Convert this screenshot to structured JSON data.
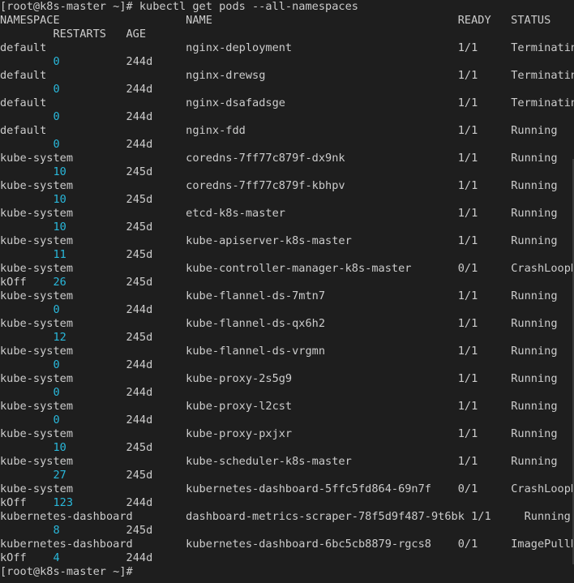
{
  "prompt_start": "[root@k8s-master ~]# kubectl get pods --all-namespaces",
  "prompt_end": "[root@k8s-master ~]#",
  "header": {
    "line1": "NAMESPACE                   NAME                                     READY   STATUS",
    "line2": "        RESTARTS   AGE"
  },
  "pods": [
    {
      "namespace": "default",
      "name": "nginx-deployment",
      "ready": "1/1",
      "status": "Terminating",
      "overflow": "",
      "restarts": "0",
      "age": "244d"
    },
    {
      "namespace": "default",
      "name": "nginx-drewsg",
      "ready": "1/1",
      "status": "Terminating",
      "overflow": "",
      "restarts": "0",
      "age": "244d"
    },
    {
      "namespace": "default",
      "name": "nginx-dsafadsge",
      "ready": "1/1",
      "status": "Terminating",
      "overflow": "",
      "restarts": "0",
      "age": "244d"
    },
    {
      "namespace": "default",
      "name": "nginx-fdd",
      "ready": "1/1",
      "status": "Running",
      "overflow": "",
      "restarts": "0",
      "age": "244d"
    },
    {
      "namespace": "kube-system",
      "name": "coredns-7ff77c879f-dx9nk",
      "ready": "1/1",
      "status": "Running",
      "overflow": "",
      "restarts": "10",
      "age": "245d"
    },
    {
      "namespace": "kube-system",
      "name": "coredns-7ff77c879f-kbhpv",
      "ready": "1/1",
      "status": "Running",
      "overflow": "",
      "restarts": "10",
      "age": "245d"
    },
    {
      "namespace": "kube-system",
      "name": "etcd-k8s-master",
      "ready": "1/1",
      "status": "Running",
      "overflow": "",
      "restarts": "10",
      "age": "245d"
    },
    {
      "namespace": "kube-system",
      "name": "kube-apiserver-k8s-master",
      "ready": "1/1",
      "status": "Running",
      "overflow": "",
      "restarts": "11",
      "age": "245d"
    },
    {
      "namespace": "kube-system",
      "name": "kube-controller-manager-k8s-master",
      "ready": "0/1",
      "status": "CrashLoopBac",
      "overflow": "kOff",
      "restarts": "26",
      "age": "245d"
    },
    {
      "namespace": "kube-system",
      "name": "kube-flannel-ds-7mtn7",
      "ready": "1/1",
      "status": "Running",
      "overflow": "",
      "restarts": "0",
      "age": "244d"
    },
    {
      "namespace": "kube-system",
      "name": "kube-flannel-ds-qx6h2",
      "ready": "1/1",
      "status": "Running",
      "overflow": "",
      "restarts": "12",
      "age": "245d"
    },
    {
      "namespace": "kube-system",
      "name": "kube-flannel-ds-vrgmn",
      "ready": "1/1",
      "status": "Running",
      "overflow": "",
      "restarts": "0",
      "age": "244d"
    },
    {
      "namespace": "kube-system",
      "name": "kube-proxy-2s5g9",
      "ready": "1/1",
      "status": "Running",
      "overflow": "",
      "restarts": "0",
      "age": "244d"
    },
    {
      "namespace": "kube-system",
      "name": "kube-proxy-l2cst",
      "ready": "1/1",
      "status": "Running",
      "overflow": "",
      "restarts": "0",
      "age": "244d"
    },
    {
      "namespace": "kube-system",
      "name": "kube-proxy-pxjxr",
      "ready": "1/1",
      "status": "Running",
      "overflow": "",
      "restarts": "10",
      "age": "245d"
    },
    {
      "namespace": "kube-system",
      "name": "kube-scheduler-k8s-master",
      "ready": "1/1",
      "status": "Running",
      "overflow": "",
      "restarts": "27",
      "age": "245d"
    },
    {
      "namespace": "kube-system",
      "name": "kubernetes-dashboard-5ffc5fd864-69n7f",
      "ready": "0/1",
      "status": "CrashLoopBac",
      "overflow": "kOff",
      "restarts": "123",
      "age": "244d"
    },
    {
      "namespace": "kubernetes-dashboard",
      "name": "dashboard-metrics-scraper-78f5d9f487-9t6bk",
      "ready": "1/1",
      "status": "Running",
      "overflow": "",
      "restarts": "8",
      "age": "245d"
    },
    {
      "namespace": "kubernetes-dashboard",
      "name": "kubernetes-dashboard-6bc5cb8879-rgcs8",
      "ready": "0/1",
      "status": "ImagePullBac",
      "overflow": "kOff",
      "restarts": "4",
      "age": "244d"
    }
  ],
  "colors": {
    "background": "#1e1e1e",
    "text": "#cccccc",
    "restarts_number": "#29b8db"
  }
}
